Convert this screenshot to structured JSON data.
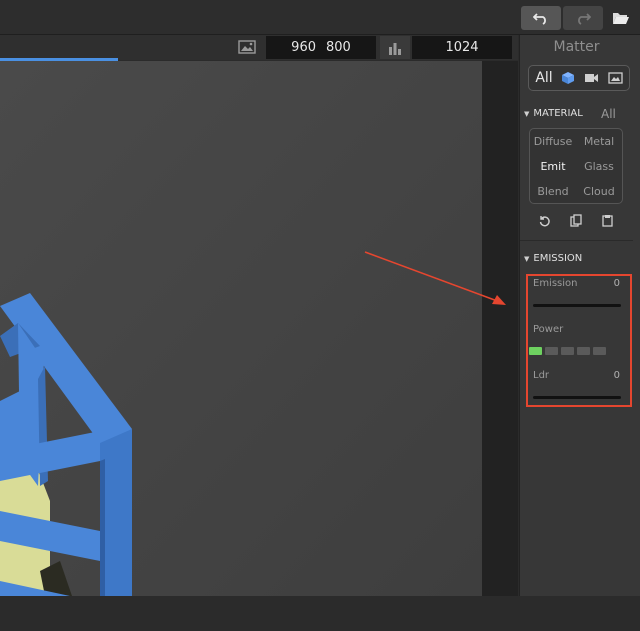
{
  "toolbar": {
    "undo_icon": "undo-icon",
    "redo_icon": "redo-icon",
    "folder_icon": "folder-open-icon"
  },
  "render_bar": {
    "width": "960",
    "height": "800",
    "samples": "1024",
    "progress_color": "#4a90e2"
  },
  "sidebar": {
    "title": "Matter",
    "mode_tabs": [
      {
        "label": "All"
      },
      {
        "icon": "cube-icon"
      },
      {
        "icon": "camera-icon"
      },
      {
        "icon": "image-icon"
      }
    ],
    "material_section": {
      "header": "MATERIAL",
      "filter": "All",
      "types": [
        "Diffuse",
        "Metal",
        "Emit",
        "Glass",
        "Blend",
        "Cloud"
      ],
      "active": "Emit",
      "tools": [
        "reset-icon",
        "copy-icon",
        "paste-icon"
      ]
    },
    "emission_section": {
      "header": "EMISSION",
      "emission_label": "Emission",
      "emission_value": "0",
      "power_label": "Power",
      "power_segments": 5,
      "power_active": 1,
      "ldr_label": "Ldr",
      "ldr_value": "0"
    }
  },
  "colors": {
    "cube_blue": "#4a86d8",
    "yellow_block": "#d9dc97",
    "annotation": "#e5462f",
    "power_on": "#6ed160"
  }
}
